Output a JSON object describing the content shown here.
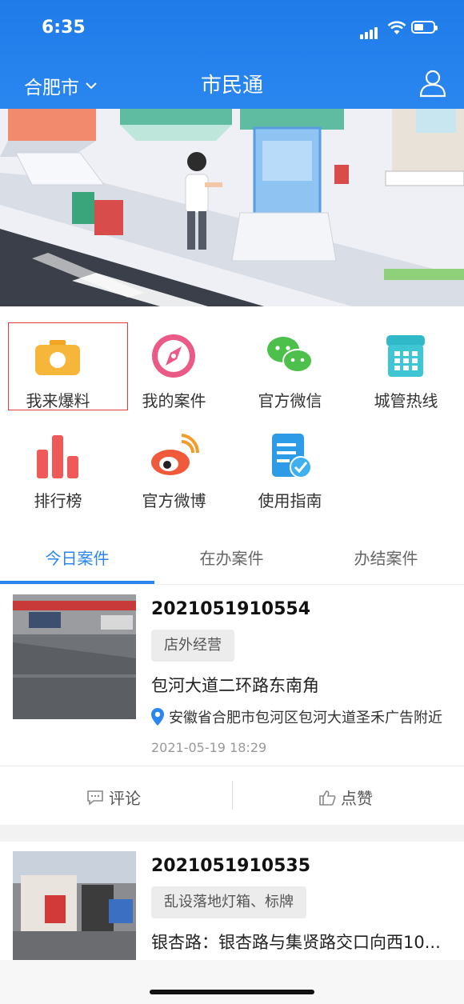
{
  "status_bar": {
    "time": "6:35"
  },
  "header": {
    "city": "合肥市",
    "title": "市民通"
  },
  "features": [
    {
      "label": "我来爆料",
      "icon": "camera-icon"
    },
    {
      "label": "我的案件",
      "icon": "compass-icon"
    },
    {
      "label": "官方微信",
      "icon": "wechat-icon"
    },
    {
      "label": "城管热线",
      "icon": "telephone-icon"
    },
    {
      "label": "排行榜",
      "icon": "bar-chart-icon"
    },
    {
      "label": "官方微博",
      "icon": "weibo-icon"
    },
    {
      "label": "使用指南",
      "icon": "guide-document-icon"
    }
  ],
  "tabs": {
    "items": [
      "今日案件",
      "在办案件",
      "办结案件"
    ],
    "active": 0
  },
  "cases": [
    {
      "id": "2021051910554",
      "tag": "店外经营",
      "address": "包河大道二环路东南角",
      "location": "安徽省合肥市包河区包河大道圣禾广告附近",
      "time": "2021-05-19 18:29",
      "comment_label": "评论",
      "like_label": "点赞"
    },
    {
      "id": "2021051910535",
      "tag": "乱设落地灯箱、标牌",
      "address": "银杏路：银杏路与集贤路交口向西10..."
    }
  ],
  "colors": {
    "primary": "#2a86ef",
    "selection": "#e23b3b"
  }
}
